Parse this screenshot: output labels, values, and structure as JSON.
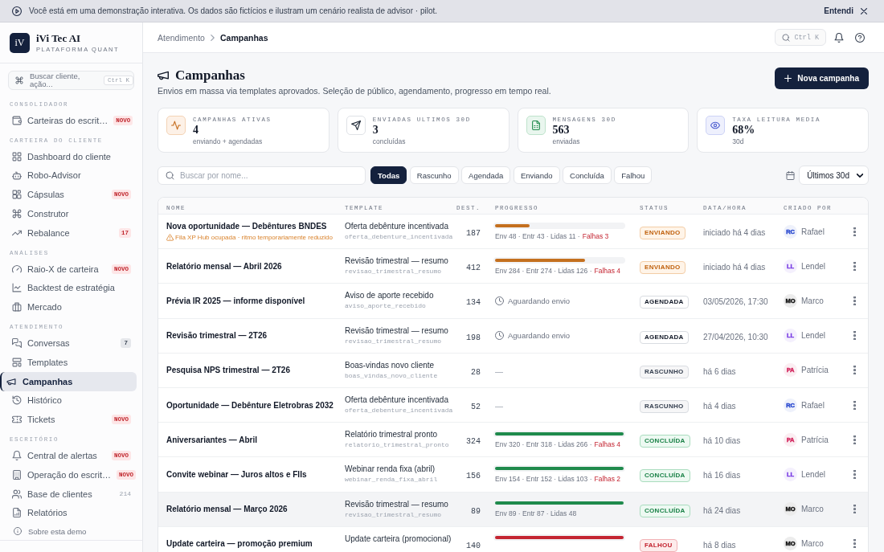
{
  "banner": {
    "text": "Você está em uma demonstração interativa. Os dados são fictícios e ilustram um cenário realista de advisor · pilot.",
    "action": "Entendi"
  },
  "sidebar": {
    "brand": {
      "logo": "iV",
      "name": "iVi Tec AI",
      "tagline": "PLATAFORMA QUANT"
    },
    "command_search": {
      "label": "Buscar cliente, ação...",
      "shortcut": "Ctrl K"
    },
    "sections": [
      {
        "title": "CONSOLIDADOR",
        "items": [
          {
            "label": "Carteiras do escrit…",
            "selected": false,
            "badge": {
              "text": "NOVO",
              "kind": "new"
            }
          }
        ]
      },
      {
        "title": "CARTEIRA DO CLIENTE",
        "items": [
          {
            "label": "Dashboard do cliente",
            "selected": false
          },
          {
            "label": "Robo-Advisor",
            "selected": false
          },
          {
            "label": "Cápsulas",
            "selected": false,
            "badge": {
              "text": "NOVO",
              "kind": "new"
            }
          },
          {
            "label": "Construtor",
            "selected": false
          },
          {
            "label": "Rebalance",
            "selected": false,
            "badge": {
              "text": "17",
              "kind": "alert"
            }
          }
        ]
      },
      {
        "title": "ANÁLISES",
        "items": [
          {
            "label": "Raio-X de carteira",
            "selected": false,
            "badge": {
              "text": "NOVO",
              "kind": "new"
            }
          },
          {
            "label": "Backtest de estratégia",
            "selected": false
          },
          {
            "label": "Mercado",
            "selected": false
          }
        ]
      },
      {
        "title": "ATENDIMENTO",
        "items": [
          {
            "label": "Conversas",
            "selected": false,
            "badge": {
              "text": "7",
              "kind": "count"
            }
          },
          {
            "label": "Templates",
            "selected": false
          },
          {
            "label": "Campanhas",
            "selected": true
          },
          {
            "label": "Histórico",
            "selected": false
          },
          {
            "label": "Tickets",
            "selected": false,
            "badge": {
              "text": "NOVO",
              "kind": "new"
            }
          }
        ]
      },
      {
        "title": "ESCRITÓRIO",
        "items": [
          {
            "label": "Central de alertas",
            "selected": false,
            "badge": {
              "text": "NOVO",
              "kind": "new"
            }
          },
          {
            "label": "Operação do escrit…",
            "selected": false,
            "badge": {
              "text": "NOVO",
              "kind": "new"
            }
          },
          {
            "label": "Base de clientes",
            "selected": false,
            "badge": {
              "text": "214",
              "kind": "plain"
            }
          },
          {
            "label": "Relatórios",
            "selected": false
          }
        ]
      }
    ],
    "footer_link": "Sobre esta demo"
  },
  "topbar": {
    "breadcrumb": [
      {
        "label": "Atendimento",
        "current": false
      },
      {
        "label": "Campanhas",
        "current": true
      }
    ],
    "search_shortcut": "Ctrl K"
  },
  "page": {
    "title": "Campanhas",
    "subtitle": "Envios em massa via templates aprovados. Seleção de público, agendamento, progresso em tempo real.",
    "action": "Nova campanha"
  },
  "stats": [
    {
      "label": "CAMPANHAS ATIVAS",
      "value": "4",
      "note": "enviando + agendadas"
    },
    {
      "label": "ENVIADAS ULTIMOS 30D",
      "value": "3",
      "note": "concluídas"
    },
    {
      "label": "MENSAGENS 30D",
      "value": "563",
      "note": "enviadas"
    },
    {
      "label": "TAXA LEITURA MEDIA",
      "value": "68%",
      "note": "30d"
    }
  ],
  "filters": {
    "search": {
      "placeholder": "Buscar por nome..."
    },
    "chips": [
      {
        "label": "Todas",
        "selected": true
      },
      {
        "label": "Rascunho",
        "selected": false
      },
      {
        "label": "Agendada",
        "selected": false
      },
      {
        "label": "Enviando",
        "selected": false
      },
      {
        "label": "Concluída",
        "selected": false
      },
      {
        "label": "Falhou",
        "selected": false
      }
    ],
    "period": {
      "value": "Últimos 30d"
    }
  },
  "table": {
    "columns": [
      "NOME",
      "TEMPLATE",
      "DEST.",
      "PROGRESSO",
      "STATUS",
      "DATA/HORA",
      "CRIADO POR"
    ],
    "rows": [
      {
        "name": "Nova oportunidade — Debêntures BNDES",
        "warning": "Fila XP Hub ocupada · ritmo temporariamente reduzido",
        "template": {
          "title": "Oferta debênture incentivada",
          "code": "oferta_debenture_incentivada"
        },
        "recipients": "187",
        "progress": {
          "kind": "bar",
          "level": 0.27,
          "stats": "Env 48 · Entr 43 · Lidas 11 ·",
          "failures": "Falhas 3"
        },
        "status": {
          "label": "ENVIANDO",
          "kind": "sending"
        },
        "date": "iniciado há 4 dias",
        "creator": {
          "initials": "RC",
          "name": "Rafael",
          "color": "#2c4bd0"
        },
        "highlighted": false
      },
      {
        "name": "Relatório mensal — Abril 2026",
        "template": {
          "title": "Revisão trimestral — resumo",
          "code": "revisao_trimestral_resumo"
        },
        "recipients": "412",
        "progress": {
          "kind": "bar",
          "level": 0.7,
          "stats": "Env 284 · Entr 274 · Lidas 126 ·",
          "failures": "Falhas 4"
        },
        "status": {
          "label": "ENVIANDO",
          "kind": "sending"
        },
        "date": "iniciado há 4 dias",
        "creator": {
          "initials": "LL",
          "name": "Lendel",
          "color": "#7b3fe4"
        },
        "highlighted": false
      },
      {
        "name": "Prévia IR 2025 — informe disponível",
        "template": {
          "title": "Aviso de aporte recebido",
          "code": "aviso_aporte_recebido"
        },
        "recipients": "134",
        "progress": {
          "kind": "waiting",
          "text": "Aguardando envio"
        },
        "status": {
          "label": "AGENDADA",
          "kind": "scheduled"
        },
        "date": "03/05/2026, 17:30",
        "creator": {
          "initials": "MO",
          "name": "Marco",
          "color": "#111111"
        },
        "highlighted": false
      },
      {
        "name": "Revisão trimestral — 2T26",
        "template": {
          "title": "Revisão trimestral — resumo",
          "code": "revisao_trimestral_resumo"
        },
        "recipients": "198",
        "progress": {
          "kind": "waiting",
          "text": "Aguardando envio"
        },
        "status": {
          "label": "AGENDADA",
          "kind": "scheduled"
        },
        "date": "27/04/2026, 10:30",
        "creator": {
          "initials": "LL",
          "name": "Lendel",
          "color": "#7b3fe4"
        },
        "highlighted": false
      },
      {
        "name": "Pesquisa NPS trimestral — 2T26",
        "template": {
          "title": "Boas-vindas novo cliente",
          "code": "boas_vindas_novo_cliente"
        },
        "recipients": "28",
        "progress": {
          "kind": "none",
          "text": "—"
        },
        "status": {
          "label": "RASCUNHO",
          "kind": "draft"
        },
        "date": "há 6 dias",
        "creator": {
          "initials": "PA",
          "name": "Patrícia",
          "color": "#d3265e"
        },
        "highlighted": false
      },
      {
        "name": "Oportunidade — Debênture Eletrobras 2032",
        "template": {
          "title": "Oferta debênture incentivada",
          "code": "oferta_debenture_incentivada"
        },
        "recipients": "52",
        "progress": {
          "kind": "none",
          "text": "—"
        },
        "status": {
          "label": "RASCUNHO",
          "kind": "draft"
        },
        "date": "há 4 dias",
        "creator": {
          "initials": "RC",
          "name": "Rafael",
          "color": "#2c4bd0"
        },
        "highlighted": false
      },
      {
        "name": "Aniversariantes — Abril",
        "template": {
          "title": "Relatório trimestral pronto",
          "code": "relatorio_trimestral_pronto"
        },
        "recipients": "324",
        "progress": {
          "kind": "bar",
          "level": 1,
          "stats": "Env 320 · Entr 318 · Lidas 266 ·",
          "failures": "Falhas 4"
        },
        "status": {
          "label": "CONCLUÍDA",
          "kind": "done"
        },
        "date": "há 10 dias",
        "creator": {
          "initials": "PA",
          "name": "Patrícia",
          "color": "#d3265e"
        },
        "highlighted": false
      },
      {
        "name": "Convite webinar — Juros altos e FIIs",
        "template": {
          "title": "Webinar renda fixa (abril)",
          "code": "webinar_renda_fixa_abril"
        },
        "recipients": "156",
        "progress": {
          "kind": "bar",
          "level": 1,
          "stats": "Env 154 · Entr 152 · Lidas 103 ·",
          "failures": "Falhas 2"
        },
        "status": {
          "label": "CONCLUÍDA",
          "kind": "done"
        },
        "date": "há 16 dias",
        "creator": {
          "initials": "LL",
          "name": "Lendel",
          "color": "#7b3fe4"
        },
        "highlighted": false
      },
      {
        "name": "Relatório mensal — Março 2026",
        "template": {
          "title": "Revisão trimestral — resumo",
          "code": "revisao_trimestral_resumo"
        },
        "recipients": "89",
        "progress": {
          "kind": "bar",
          "level": 1,
          "stats": "Env 89 · Entr 87 · Lidas 48"
        },
        "status": {
          "label": "CONCLUÍDA",
          "kind": "done"
        },
        "date": "há 24 dias",
        "creator": {
          "initials": "MO",
          "name": "Marco",
          "color": "#111111"
        },
        "highlighted": true
      },
      {
        "name": "Update carteira — promoção premium",
        "template": {
          "title": "Update carteira (promocional)"
        },
        "recipients": "140",
        "progress": {
          "kind": "bar",
          "level": 1
        },
        "status": {
          "label": "FALHOU",
          "kind": "failed"
        },
        "date": "há 8 dias",
        "creator": {
          "initials": "MO",
          "name": "Marco",
          "color": "#111111"
        },
        "highlighted": false
      }
    ]
  }
}
